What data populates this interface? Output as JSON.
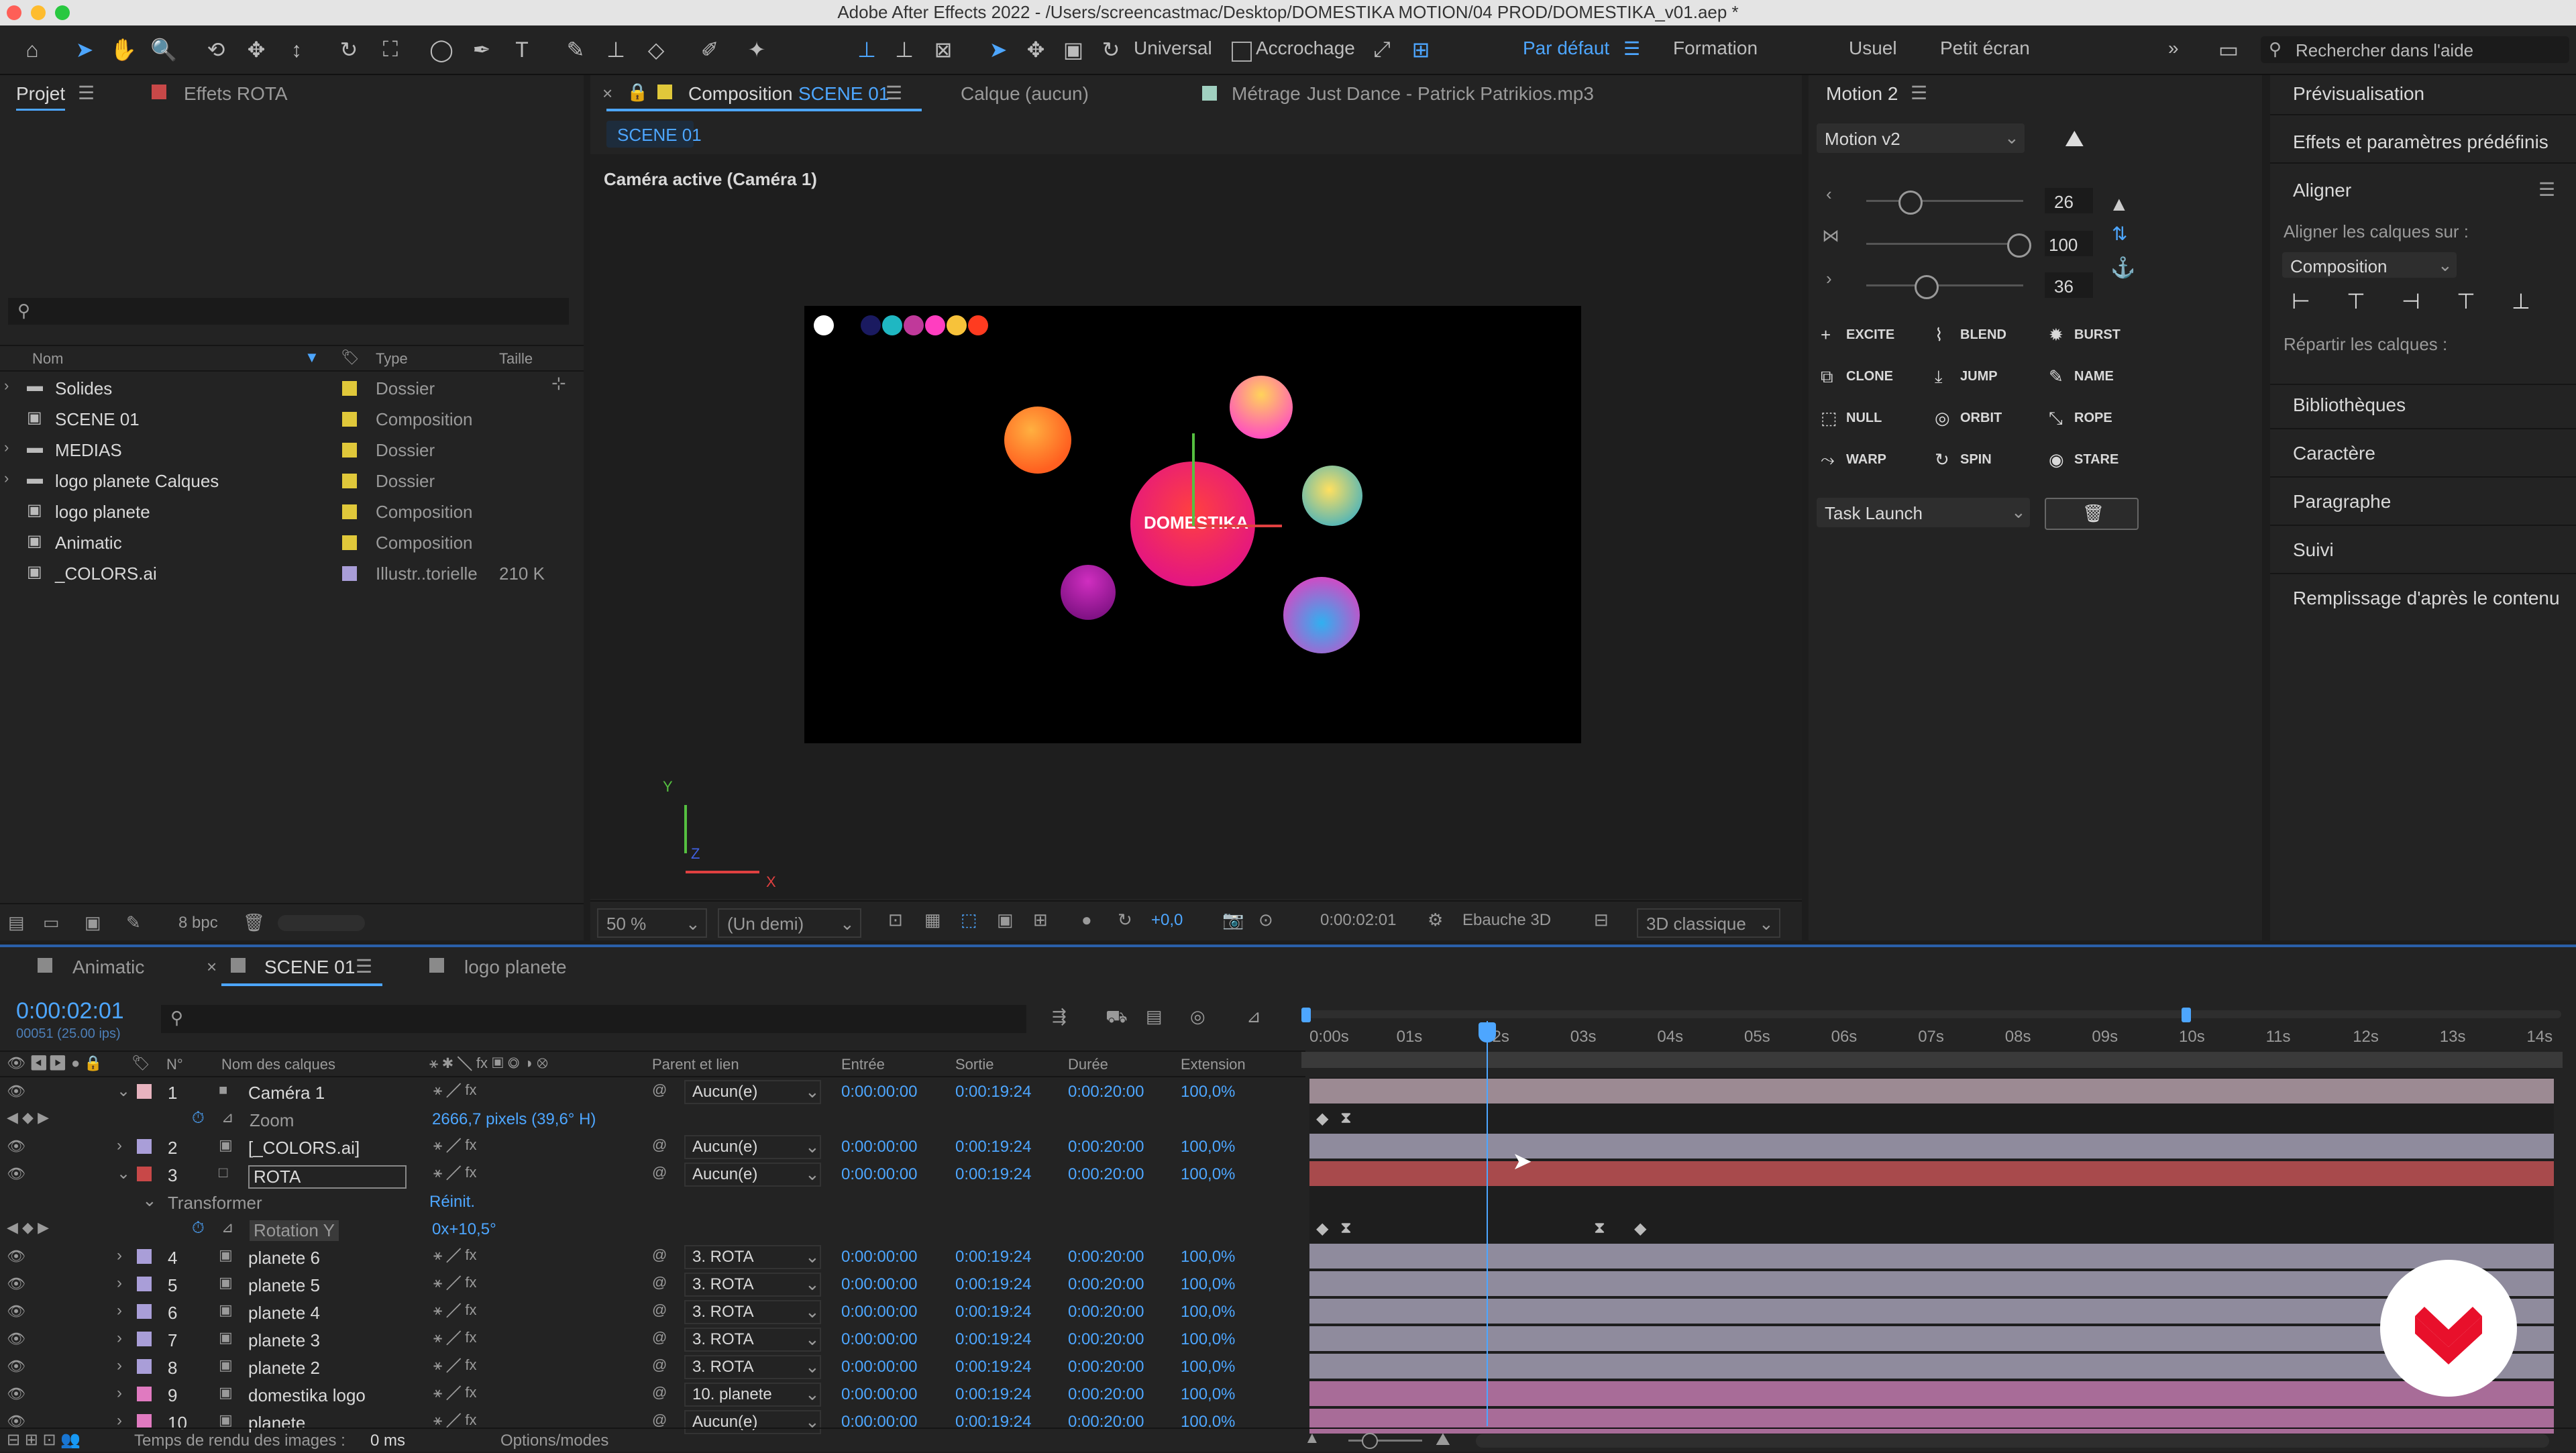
{
  "window": {
    "title": "Adobe After Effects 2022 - /Users/screencastmac/Desktop/DOMESTIKA MOTION/04 PROD/DOMESTIKA_v01.aep *"
  },
  "toolbar": {
    "universal": "Universal",
    "snap": "Accrochage",
    "workspaces": [
      "Par défaut",
      "Formation",
      "Usuel",
      "Petit écran"
    ],
    "search_placeholder": "Rechercher dans l'aide"
  },
  "project": {
    "tab": "Projet",
    "effects_tab": "Effets  ROTA",
    "columns": {
      "name": "Nom",
      "type": "Type",
      "size": "Taille"
    },
    "items": [
      {
        "name": "Solides",
        "type": "Dossier",
        "size": "",
        "color": "#e0c83a"
      },
      {
        "name": "SCENE 01",
        "type": "Composition",
        "size": "",
        "color": "#e0c83a"
      },
      {
        "name": "MEDIAS",
        "type": "Dossier",
        "size": "",
        "color": "#e0c83a"
      },
      {
        "name": "logo planete Calques",
        "type": "Dossier",
        "size": "",
        "color": "#e0c83a"
      },
      {
        "name": "logo planete",
        "type": "Composition",
        "size": "",
        "color": "#e0c83a"
      },
      {
        "name": "Animatic",
        "type": "Composition",
        "size": "",
        "color": "#e0c83a"
      },
      {
        "name": "_COLORS.ai",
        "type": "Illustr..torielle",
        "size": "210 K",
        "color": "#a99ed8"
      }
    ],
    "bpc": "8 bpc"
  },
  "composition": {
    "tab_label": "Composition",
    "tab_name": "SCENE 01",
    "layer_label": "Calque",
    "layer_value": "(aucun)",
    "footage_label": "Métrage",
    "footage_value": "Just Dance - Patrick Patrikios.mp3",
    "subtab": "SCENE 01",
    "camera": "Caméra active (Caméra 1)",
    "logo_text": "DOMESTIKA",
    "zoom": "50 %",
    "resolution": "(Un demi)",
    "exposure": "+0,0",
    "timecode": "0:00:02:01",
    "renderer": "Ebauche 3D",
    "view": "3D classique"
  },
  "motion": {
    "title": "Motion 2",
    "version": "Motion v2",
    "values": [
      "26",
      "100",
      "36"
    ],
    "buttons": [
      "EXCITE",
      "BLEND",
      "BURST",
      "CLONE",
      "JUMP",
      "NAME",
      "NULL",
      "ORBIT",
      "ROPE",
      "WARP",
      "SPIN",
      "STARE"
    ],
    "task": "Task Launch"
  },
  "right_panel": {
    "preview": "Prévisualisation",
    "effects": "Effets et paramètres prédéfinis",
    "align": "Aligner",
    "align_to_label": "Aligner les calques sur :",
    "align_to": "Composition",
    "distribute": "Répartir les calques :",
    "sections": [
      "Bibliothèques",
      "Caractère",
      "Paragraphe",
      "Suivi",
      "Remplissage d'après le contenu"
    ]
  },
  "timeline": {
    "tabs": [
      "Animatic",
      "SCENE 01",
      "logo planete"
    ],
    "timecode": "0:00:02:01",
    "fps": "00051 (25.00 ips)",
    "columns": {
      "num": "N°",
      "name": "Nom des calques",
      "parent": "Parent et lien",
      "in": "Entrée",
      "out": "Sortie",
      "dur": "Durée",
      "stretch": "Extension"
    },
    "ruler": [
      "0:00s",
      "01s",
      "02s",
      "03s",
      "04s",
      "05s",
      "06s",
      "07s",
      "08s",
      "09s",
      "10s",
      "11s",
      "12s",
      "13s",
      "14s"
    ],
    "layers": [
      {
        "num": "1",
        "name": "Caméra 1",
        "parent": "Aucun(e)",
        "in": "0:00:00:00",
        "out": "0:00:19:24",
        "dur": "0:00:20:00",
        "stretch": "100,0%",
        "color": "#e7b3bf",
        "bar": "#9c8a93",
        "open": true
      },
      {
        "prop": "Zoom",
        "value": "2666,7 pixels (39,6° H)"
      },
      {
        "num": "2",
        "name": "[_COLORS.ai]",
        "parent": "Aucun(e)",
        "in": "0:00:00:00",
        "out": "0:00:19:24",
        "dur": "0:00:20:00",
        "stretch": "100,0%",
        "color": "#a99ed8",
        "bar": "#8f8b9d",
        "open": false
      },
      {
        "num": "3",
        "name": "ROTA",
        "parent": "Aucun(e)",
        "in": "0:00:00:00",
        "out": "0:00:19:24",
        "dur": "0:00:20:00",
        "stretch": "100,0%",
        "color": "#c84848",
        "bar": "#a84a4c",
        "open": true
      },
      {
        "group": "Transformer",
        "reset": "Réinit."
      },
      {
        "prop": "Rotation Y",
        "value": "0x+10,5°"
      },
      {
        "num": "4",
        "name": "planete 6",
        "parent": "3. ROTA",
        "in": "0:00:00:00",
        "out": "0:00:19:24",
        "dur": "0:00:20:00",
        "stretch": "100,0%",
        "color": "#a99ed8",
        "bar": "#8f8b9d",
        "open": false
      },
      {
        "num": "5",
        "name": "planete 5",
        "parent": "3. ROTA",
        "in": "0:00:00:00",
        "out": "0:00:19:24",
        "dur": "0:00:20:00",
        "stretch": "100,0%",
        "color": "#a99ed8",
        "bar": "#8f8b9d",
        "open": false
      },
      {
        "num": "6",
        "name": "planete 4",
        "parent": "3. ROTA",
        "in": "0:00:00:00",
        "out": "0:00:19:24",
        "dur": "0:00:20:00",
        "stretch": "100,0%",
        "color": "#a99ed8",
        "bar": "#8f8b9d",
        "open": false
      },
      {
        "num": "7",
        "name": "planete 3",
        "parent": "3. ROTA",
        "in": "0:00:00:00",
        "out": "0:00:19:24",
        "dur": "0:00:20:00",
        "stretch": "100,0%",
        "color": "#a99ed8",
        "bar": "#8f8b9d",
        "open": false
      },
      {
        "num": "8",
        "name": "planete 2",
        "parent": "3. ROTA",
        "in": "0:00:00:00",
        "out": "0:00:19:24",
        "dur": "0:00:20:00",
        "stretch": "100,0%",
        "color": "#a99ed8",
        "bar": "#8f8b9d",
        "open": false
      },
      {
        "num": "9",
        "name": "domestika logo",
        "parent": "10. planete",
        "in": "0:00:00:00",
        "out": "0:00:19:24",
        "dur": "0:00:20:00",
        "stretch": "100,0%",
        "color": "#e07ac0",
        "bar": "#a86c98",
        "open": false
      },
      {
        "num": "10",
        "name": "planete",
        "parent": "Aucun(e)",
        "in": "0:00:00:00",
        "out": "0:00:19:24",
        "dur": "0:00:20:00",
        "stretch": "100,0%",
        "color": "#e07ac0",
        "bar": "#a86c98",
        "open": false
      }
    ],
    "status": "Temps de rendu des images :",
    "status_value": "0 ms",
    "options": "Options/modes"
  }
}
